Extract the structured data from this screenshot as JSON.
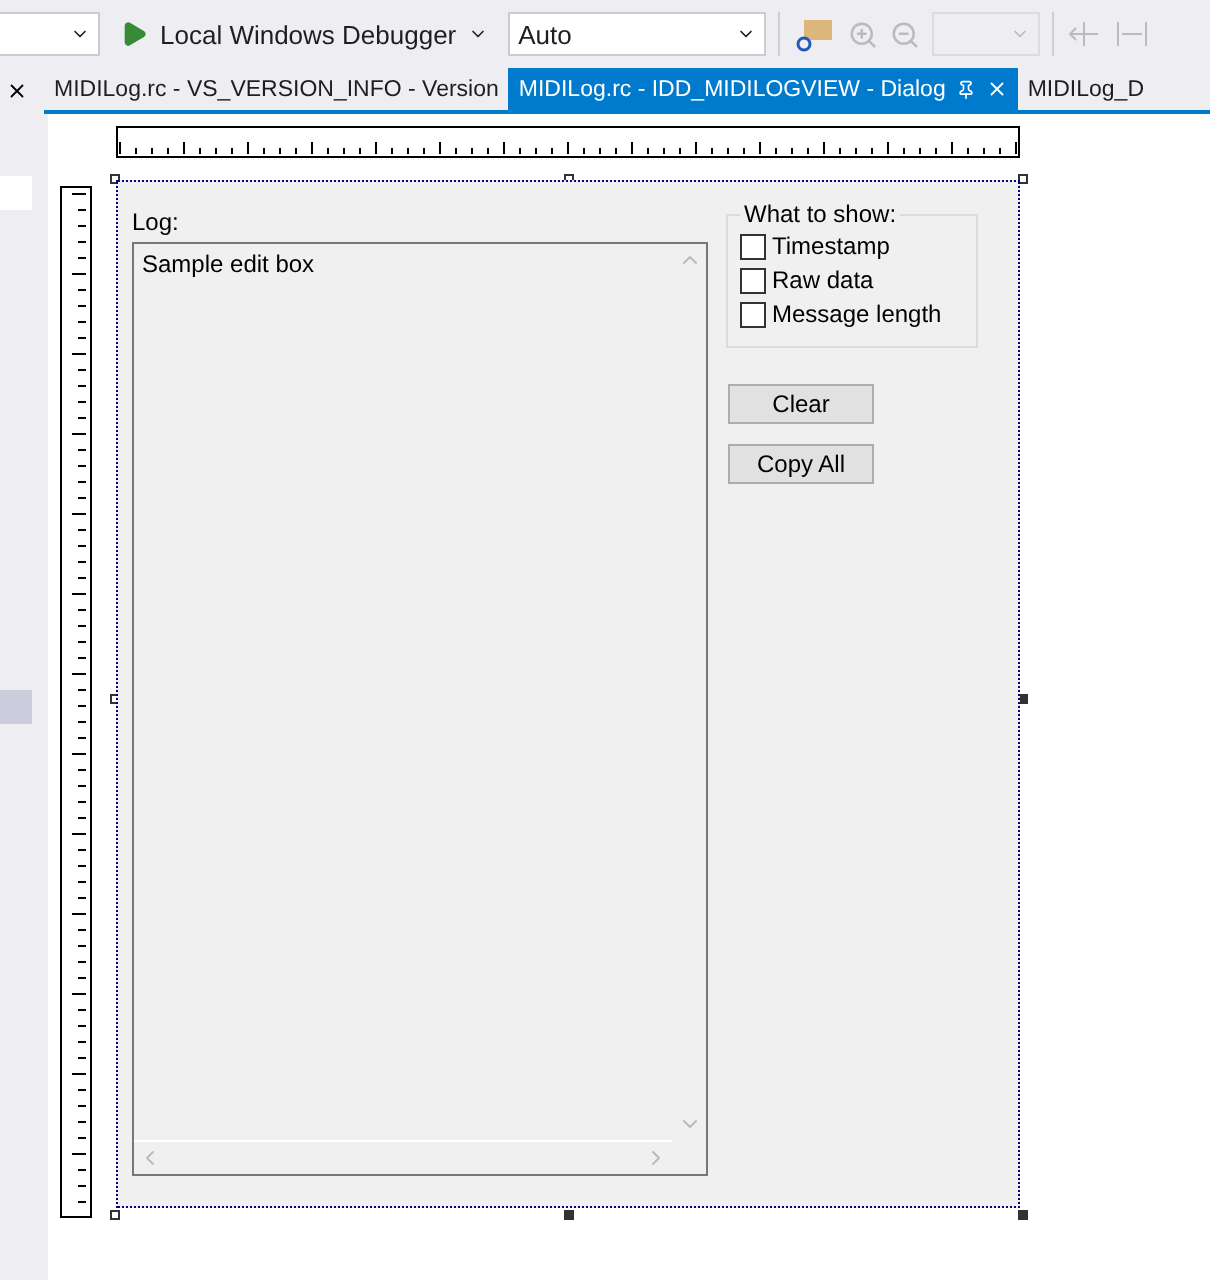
{
  "toolbar": {
    "debugger": "Local Windows Debugger",
    "config": "Auto"
  },
  "tabs": [
    {
      "label": "MIDILog.rc - VS_VERSION_INFO - Version",
      "selected": false
    },
    {
      "label": "MIDILog.rc - IDD_MIDILOGVIEW - Dialog",
      "selected": true
    },
    {
      "label": "MIDILog_D",
      "selected": false
    }
  ],
  "dialog": {
    "log_label": "Log:",
    "edit_text": "Sample edit box",
    "group_title": "What to show:",
    "options": [
      {
        "label": "Timestamp",
        "checked": false
      },
      {
        "label": "Raw data",
        "checked": false
      },
      {
        "label": "Message length",
        "checked": false
      }
    ],
    "buttons": [
      "Clear",
      "Copy All"
    ]
  }
}
